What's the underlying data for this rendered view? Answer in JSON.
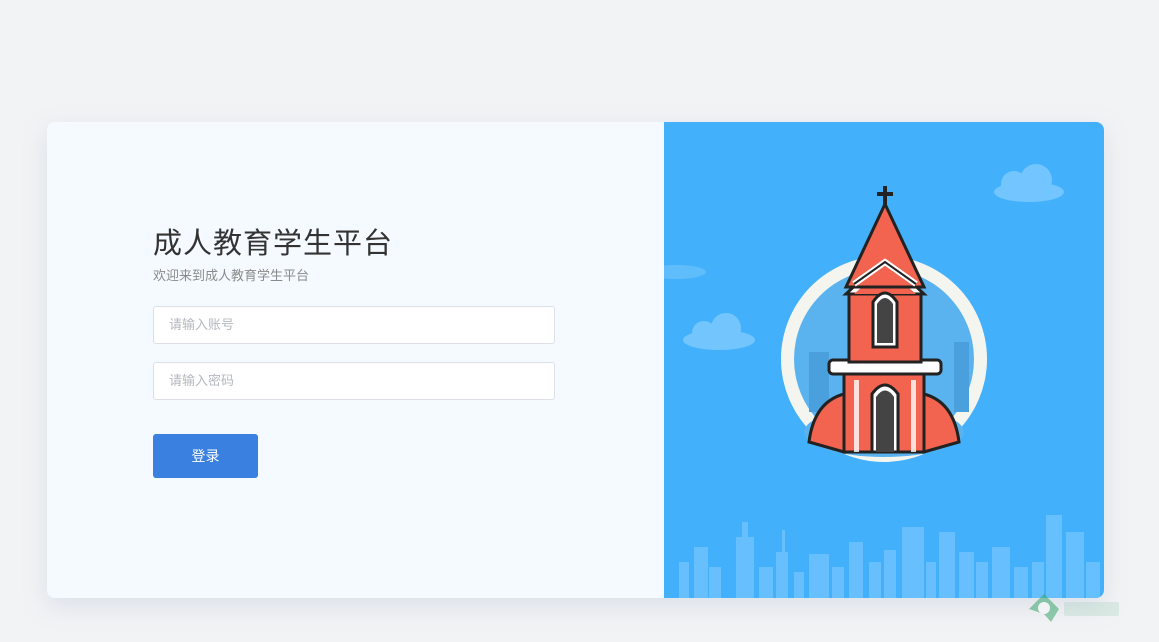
{
  "login": {
    "title": "成人教育学生平台",
    "subtitle": "欢迎来到成人教育学生平台",
    "account_placeholder": "请输入账号",
    "password_placeholder": "请输入密码",
    "submit_label": "登录"
  },
  "colors": {
    "page_bg": "#f2f3f5",
    "form_panel_bg": "#f4faff",
    "illustration_bg": "#43b0fb",
    "primary_button": "#3a80e0",
    "church_red": "#f26350"
  },
  "illustration": {
    "icons": [
      "church-icon",
      "cloud-icon",
      "city-skyline-icon"
    ]
  }
}
